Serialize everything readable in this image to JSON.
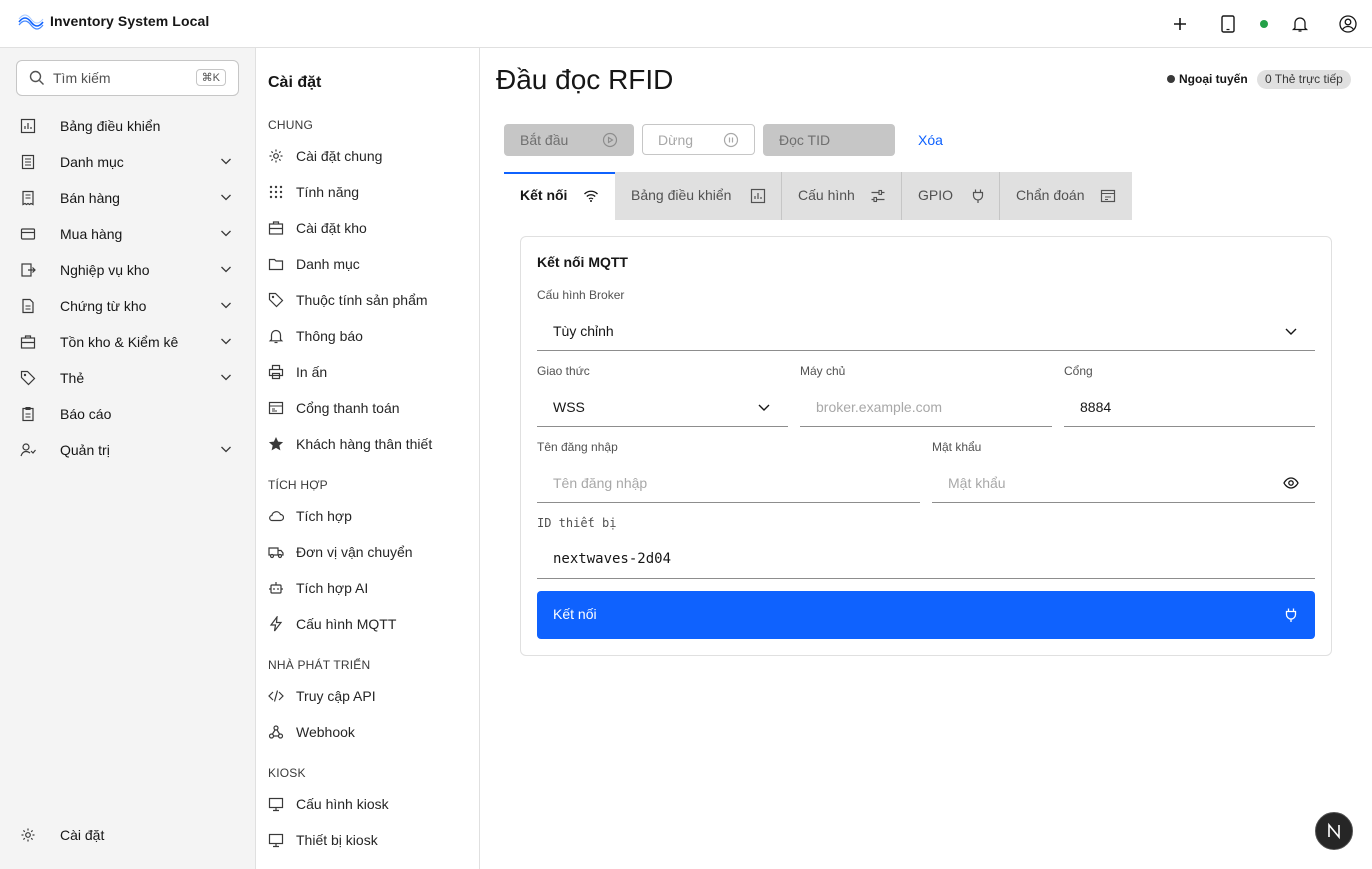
{
  "app": {
    "title": "Inventory System Local"
  },
  "header": {
    "icons": [
      "plus-icon",
      "tablet-icon",
      "status-online-dot",
      "bell-icon",
      "user-avatar-icon"
    ]
  },
  "sidebar": {
    "search": {
      "placeholder": "Tìm kiếm",
      "shortcut": "⌘K"
    },
    "items": [
      {
        "label": "Bảng điều khiển",
        "icon": "dashboard-icon",
        "expandable": false
      },
      {
        "label": "Danh mục",
        "icon": "catalog-icon",
        "expandable": true
      },
      {
        "label": "Bán hàng",
        "icon": "receipt-icon",
        "expandable": true
      },
      {
        "label": "Mua hàng",
        "icon": "credit-card-icon",
        "expandable": true
      },
      {
        "label": "Nghiệp vụ kho",
        "icon": "transfer-icon",
        "expandable": true
      },
      {
        "label": "Chứng từ kho",
        "icon": "document-icon",
        "expandable": true
      },
      {
        "label": "Tồn kho & Kiểm kê",
        "icon": "warehouse-icon",
        "expandable": true
      },
      {
        "label": "Thẻ",
        "icon": "tag-icon",
        "expandable": true
      },
      {
        "label": "Báo cáo",
        "icon": "report-icon",
        "expandable": false
      },
      {
        "label": "Quản trị",
        "icon": "admin-icon",
        "expandable": true
      }
    ],
    "footer": {
      "label": "Cài đặt",
      "icon": "gear-icon"
    }
  },
  "settings": {
    "title": "Cài đặt",
    "sections": [
      {
        "heading": "CHUNG",
        "items": [
          "Cài đặt chung",
          "Tính năng",
          "Cài đặt kho",
          "Danh mục",
          "Thuộc tính sản phẩm",
          "Thông báo",
          "In ấn",
          "Cổng thanh toán",
          "Khách hàng thân thiết"
        ]
      },
      {
        "heading": "TÍCH HỢP",
        "items": [
          "Tích hợp",
          "Đơn vị vận chuyển",
          "Tích hợp AI",
          "Cấu hình MQTT"
        ]
      },
      {
        "heading": "NHÀ PHÁT TRIỂN",
        "items": [
          "Truy cập API",
          "Webhook"
        ]
      },
      {
        "heading": "KIOSK",
        "items": [
          "Cấu hình kiosk",
          "Thiết bị kiosk"
        ]
      }
    ]
  },
  "main": {
    "title": "Đầu đọc RFID",
    "status": {
      "label": "Ngoại tuyến",
      "live_tags": "0 Thẻ trực tiếp"
    },
    "actions": {
      "start": "Bắt đầu",
      "stop": "Dừng",
      "read_tid": "Đọc TID",
      "clear": "Xóa"
    },
    "tabs": [
      {
        "label": "Kết nối",
        "icon": "wifi-icon",
        "active": true
      },
      {
        "label": "Bảng điều khiển",
        "icon": "dashboard-icon",
        "active": false
      },
      {
        "label": "Cấu hình",
        "icon": "sliders-icon",
        "active": false
      },
      {
        "label": "GPIO",
        "icon": "plug-icon",
        "active": false
      },
      {
        "label": "Chẩn đoán",
        "icon": "diagnostics-icon",
        "active": false
      }
    ],
    "card": {
      "title": "Kết nối MQTT",
      "broker": {
        "label": "Cấu hình Broker",
        "value": "Tùy chỉnh"
      },
      "protocol": {
        "label": "Giao thức",
        "value": "WSS"
      },
      "host": {
        "label": "Máy chủ",
        "placeholder": "broker.example.com"
      },
      "port": {
        "label": "Cổng",
        "value": "8884"
      },
      "username": {
        "label": "Tên đăng nhập",
        "placeholder": "Tên đăng nhập"
      },
      "password": {
        "label": "Mật khẩu",
        "placeholder": "Mật khẩu"
      },
      "device_id": {
        "label": "ID thiết bị",
        "value": "nextwaves-2d04"
      },
      "connect": "Kết nối"
    }
  },
  "fab": {
    "letter": "N"
  },
  "colors": {
    "primary": "#0f62fe",
    "online": "#24a148",
    "sidebar_bg": "#f4f4f4"
  }
}
